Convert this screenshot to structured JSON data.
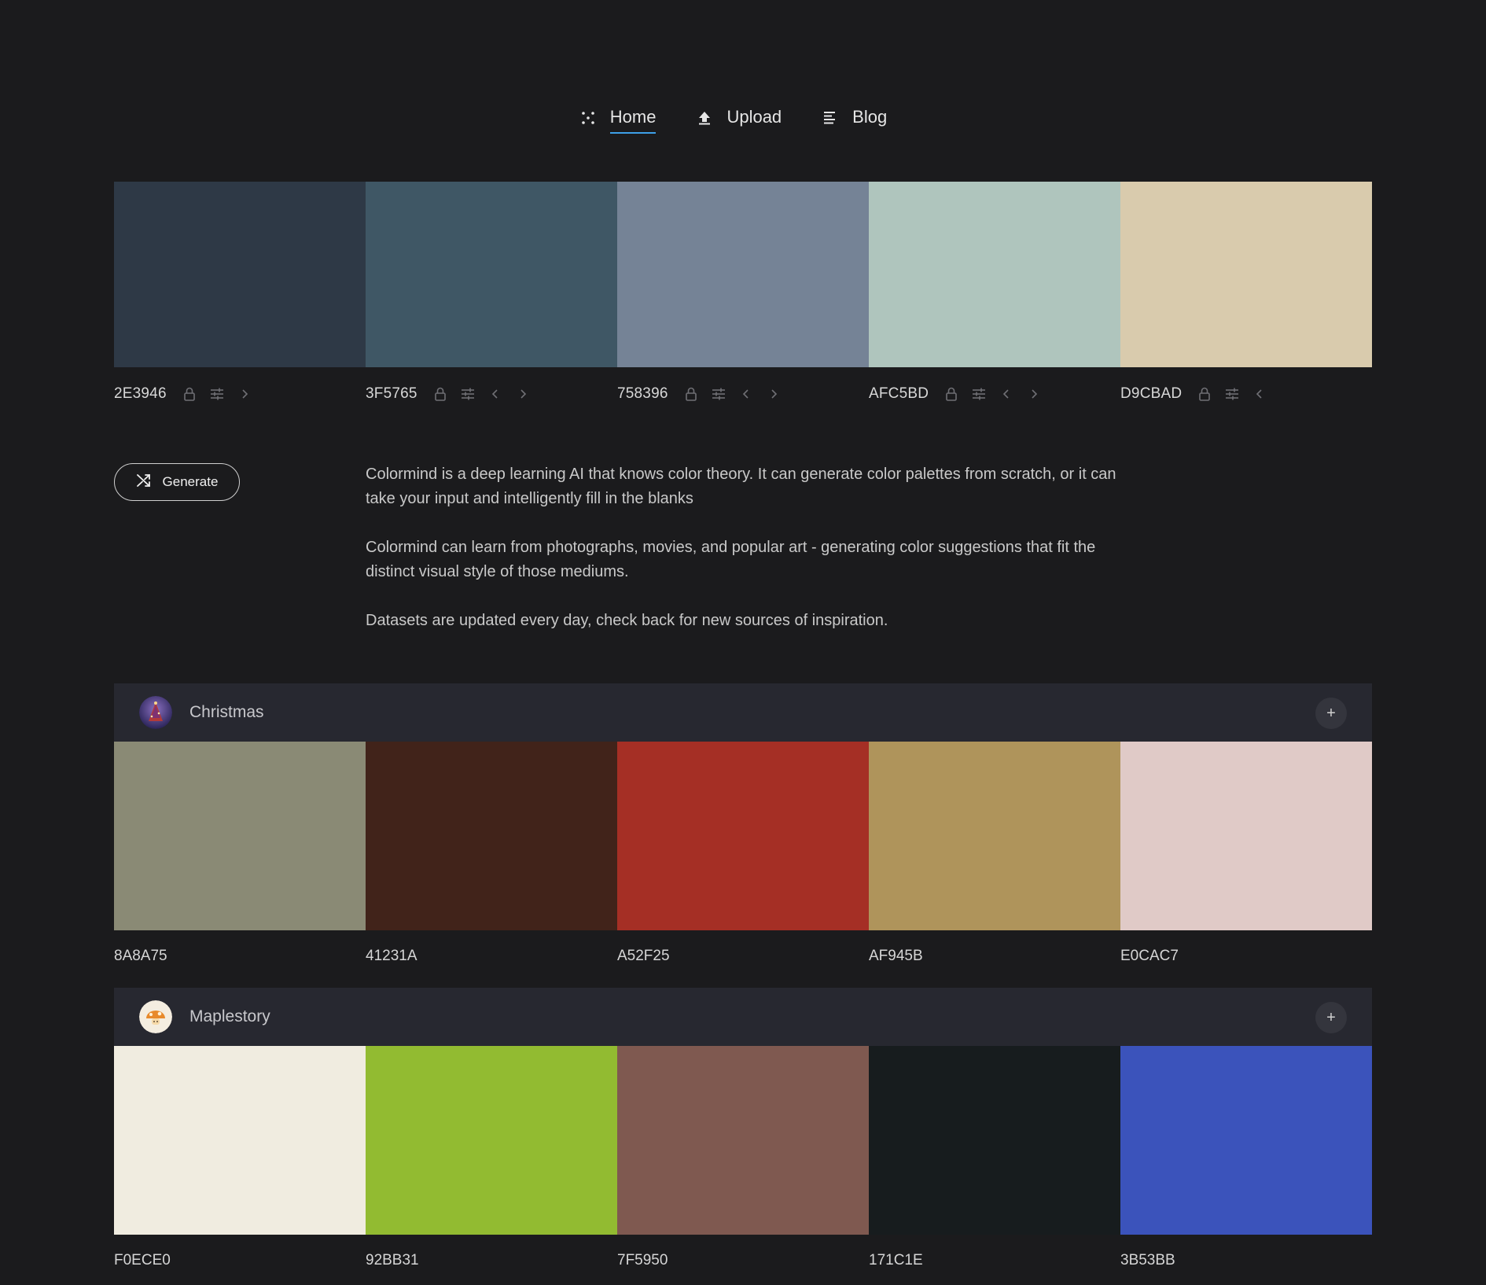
{
  "nav": {
    "items": [
      {
        "label": "Home",
        "icon": "dots-icon",
        "active": true
      },
      {
        "label": "Upload",
        "icon": "upload-icon",
        "active": false
      },
      {
        "label": "Blog",
        "icon": "blog-icon",
        "active": false
      }
    ]
  },
  "main_palette": [
    {
      "hex": "2E3946",
      "color": "#2E3946"
    },
    {
      "hex": "3F5765",
      "color": "#3F5765"
    },
    {
      "hex": "758396",
      "color": "#758396"
    },
    {
      "hex": "AFC5BD",
      "color": "#AFC5BD"
    },
    {
      "hex": "D9CBAD",
      "color": "#D9CBAD"
    }
  ],
  "generate_label": "Generate",
  "description": [
    "Colormind is a deep learning AI that knows color theory. It can generate color palettes from scratch, or it can take your input and intelligently fill in the blanks",
    "Colormind can learn from photographs, movies, and popular art - generating color suggestions that fit the distinct visual style of those mediums.",
    "Datasets are updated every day, check back for new sources of inspiration."
  ],
  "palettes": [
    {
      "title": "Christmas",
      "add_label": "+",
      "colors": [
        {
          "hex": "8A8A75",
          "color": "#8A8A75"
        },
        {
          "hex": "41231A",
          "color": "#41231A"
        },
        {
          "hex": "A52F25",
          "color": "#A52F25"
        },
        {
          "hex": "AF945B",
          "color": "#AF945B"
        },
        {
          "hex": "E0CAC7",
          "color": "#E0CAC7"
        }
      ]
    },
    {
      "title": "Maplestory",
      "add_label": "+",
      "colors": [
        {
          "hex": "F0ECE0",
          "color": "#F0ECE0"
        },
        {
          "hex": "92BB31",
          "color": "#92BB31"
        },
        {
          "hex": "7F5950",
          "color": "#7F5950"
        },
        {
          "hex": "171C1E",
          "color": "#171C1E"
        },
        {
          "hex": "3B53BB",
          "color": "#3B53BB"
        }
      ]
    }
  ],
  "colors": {
    "accent": "#3ea0e8",
    "background": "#1b1b1d",
    "card_header": "#272830"
  }
}
